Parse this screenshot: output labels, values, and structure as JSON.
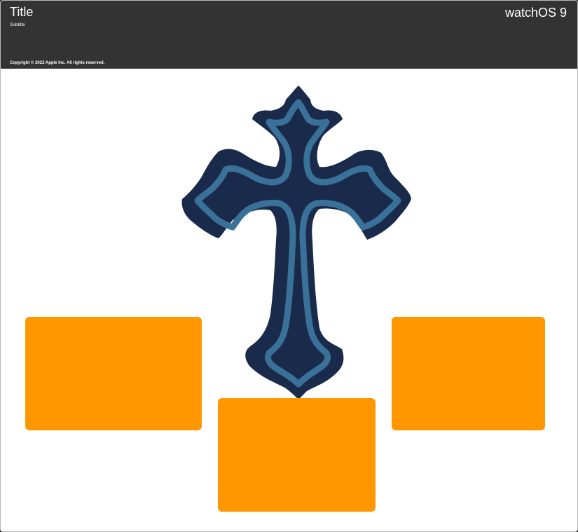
{
  "header": {
    "title": "Title",
    "subtitle": "Subtitle",
    "platform": "watchOS 9",
    "copyright": "Copyright © 2022 Apple Inc. All rights reserved."
  },
  "colors": {
    "header_bg": "#333333",
    "canvas_bg": "#ffffff",
    "panel": "#ff9800",
    "cross_fill": "#1a2a4a",
    "cross_outline": "#3a7199"
  },
  "canvas": {
    "image": "cross-illustration",
    "panels": [
      "orange-panel",
      "orange-panel",
      "orange-panel"
    ]
  }
}
